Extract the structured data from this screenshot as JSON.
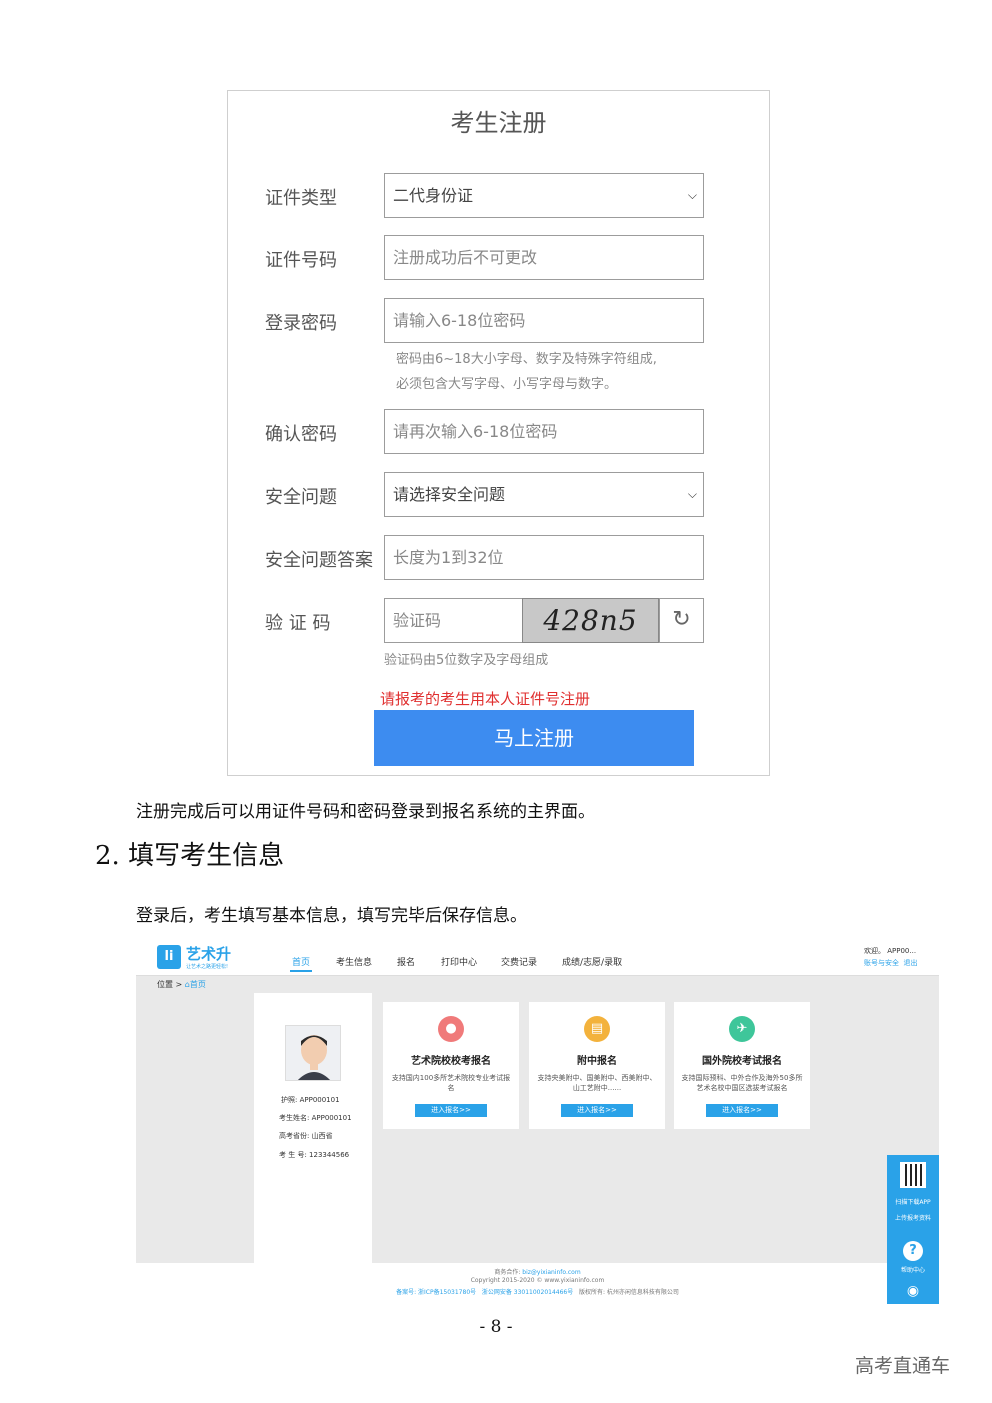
{
  "reg": {
    "title": "考生注册",
    "labels": {
      "id_type": "证件类型",
      "id_no": "证件号码",
      "password": "登录密码",
      "confirm": "确认密码",
      "question": "安全问题",
      "answer": "安全问题答案",
      "captcha": "验 证 码"
    },
    "id_type_value": "二代身份证",
    "id_no_placeholder": "注册成功后不可更改",
    "password_placeholder": "请输入6-18位密码",
    "password_hint_1": "密码由6~18大小字母、数字及特殊字符组成,",
    "password_hint_2": "必须包含大写字母、小写字母与数字。",
    "confirm_placeholder": "请再次输入6-18位密码",
    "question_value": "请选择安全问题",
    "answer_placeholder": "长度为1到32位",
    "captcha_placeholder": "验证码",
    "captcha_image_text": "428n5",
    "captcha_hint": "验证码由5位数字及字母组成",
    "warning": "请报考的考生用本人证件号注册",
    "submit": "马上注册"
  },
  "text": {
    "para1": "注册完成后可以用证件号码和密码登录到报名系统的主界面。",
    "heading": "2. 填写考生信息",
    "para2": "登录后，考生填写基本信息，填写完毕后保存信息。",
    "page_number": "- 8 -",
    "watermark": "高考直通车"
  },
  "app": {
    "logo_text": "艺术升",
    "logo_sub": "让艺术之路更轻松!",
    "nav": [
      "首页",
      "考生信息",
      "报名",
      "打印中心",
      "交费记录",
      "成绩/志愿/录取"
    ],
    "welcome": "欢迎。 APP00...",
    "account": "账号与安全",
    "logout": "退出",
    "crumb_prefix": "位置 >",
    "crumb_home": "首页",
    "profile": {
      "passport": "护照: APP000101",
      "name": "考生姓名: APP000101",
      "province": "高考省份: 山西省",
      "exam_no": "考 生 号: 123344566"
    },
    "cards": [
      {
        "title": "艺术院校校考报名",
        "desc": "支持国内100多所艺术院校专业考试报名",
        "button": "进入报名>>"
      },
      {
        "title": "附中报名",
        "desc": "支持央美附中、国美附中、西美附中、山工艺附中......",
        "button": "进入报名>>"
      },
      {
        "title": "国外院校考试报名",
        "desc": "支持国际预科、中外合作及海外50多所艺术名校中国区选拔考试报名",
        "button": "进入报名>>"
      }
    ],
    "footer": {
      "biz_label": "商务合作:",
      "biz_email": "biz@yixianinfo.com",
      "copyright": "Copyright 2015-2020 © www.yixianinfo.com",
      "icp": "备案号: 浙ICP备15031780号",
      "police": "浙公网安备 33011002014466号",
      "owner": "版权所有: 杭州亦闲信息科技有限公司"
    },
    "side": {
      "download": "扫描下载APP",
      "upload": "上传报考资料",
      "help": "帮助中心"
    }
  },
  "colors": {
    "accent": "#3d8cf0",
    "app_blue": "#2aa2e8",
    "warning": "#e03030"
  }
}
